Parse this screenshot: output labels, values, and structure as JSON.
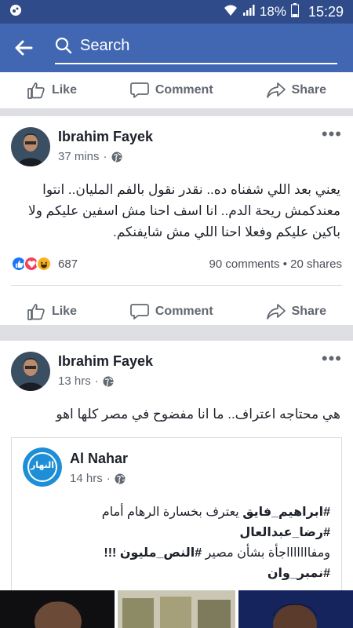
{
  "statusbar": {
    "battery": "18%",
    "time": "15:29"
  },
  "search": {
    "placeholder": "Search"
  },
  "actions": {
    "like": "Like",
    "comment": "Comment",
    "share": "Share"
  },
  "post1": {
    "author": "Ibrahim Fayek",
    "time": "37 mins",
    "dot": "·",
    "text": "يعني بعد اللي شفناه ده.. نقدر نقول بالفم المليان.. انتوا معندكمش ريحة الدم.. انا اسف احنا مش اسفين عليكم ولا باكين عليكم وفعلا احنا اللي مش شايفنكم.",
    "reactions_count": "687",
    "stats": "90 comments • 20 shares",
    "more": "•••"
  },
  "post2": {
    "author": "Ibrahim Fayek",
    "time": "13 hrs",
    "dot": "·",
    "text": "هي محتاجه اعتراف.. ما انا مفضوح في مصر كلها اهو",
    "more": "•••",
    "shared": {
      "page_name": "Al Nahar",
      "logo_text": "النهار",
      "time": "14 hrs",
      "dot": "·",
      "line1_tag": "#ابراهيم_فايق",
      "line1_rest": " يعترف بخسارة الرهام أمام",
      "line2_tag": "#رضا_عبدالعال",
      "line3_rest": "ومفاااااااجأة بشأن مصير ",
      "line3_tag": "#النص_مليون",
      "line3_end": " !!!",
      "line4_tag": "#نمبر_وان"
    }
  },
  "colors": {
    "brand": "#4267b2",
    "statusbar": "#2f4b8a",
    "like": "#1877f2",
    "love": "#f33e58",
    "haha": "#f7b125"
  }
}
